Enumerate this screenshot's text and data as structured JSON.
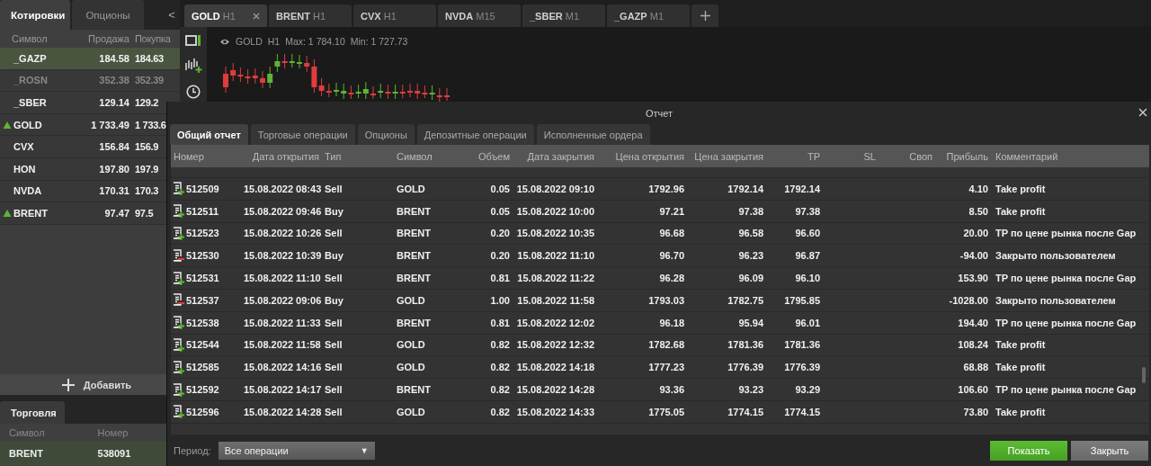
{
  "quotes_panel": {
    "tabs": [
      {
        "label": "Котировки",
        "selected": true
      },
      {
        "label": "Опционы",
        "selected": false
      }
    ],
    "collapse": "<",
    "columns": [
      "Символ",
      "Продажа",
      "Покупка"
    ],
    "rows": [
      {
        "symbol": "_GAZP",
        "sell": "184.58",
        "buy": "184.63",
        "selected": true,
        "disabled": false,
        "up": false
      },
      {
        "symbol": "_ROSN",
        "sell": "352.38",
        "buy": "352.39",
        "selected": false,
        "disabled": true,
        "up": false
      },
      {
        "symbol": "_SBER",
        "sell": "129.14",
        "buy": "129.2",
        "selected": false,
        "disabled": false,
        "up": false
      },
      {
        "symbol": "GOLD",
        "sell": "1 733.49",
        "buy": "1 733.6",
        "selected": false,
        "disabled": false,
        "up": true
      },
      {
        "symbol": "CVX",
        "sell": "156.84",
        "buy": "156.9",
        "selected": false,
        "disabled": false,
        "up": false
      },
      {
        "symbol": "HON",
        "sell": "197.80",
        "buy": "197.9",
        "selected": false,
        "disabled": false,
        "up": false
      },
      {
        "symbol": "NVDA",
        "sell": "170.31",
        "buy": "170.3",
        "selected": false,
        "disabled": false,
        "up": false
      },
      {
        "symbol": "BRENT",
        "sell": "97.47",
        "buy": "97.5",
        "selected": false,
        "disabled": false,
        "up": true
      }
    ],
    "add_button": "Добавить"
  },
  "trading_panel": {
    "tab": "Торговля",
    "columns": [
      "Символ",
      "Номер"
    ],
    "rows": [
      {
        "symbol": "BRENT",
        "number": "538091",
        "selected": true
      }
    ]
  },
  "chart_tabs": [
    {
      "symbol": "GOLD",
      "timeframe": "H1",
      "selected": true
    },
    {
      "symbol": "BRENT",
      "timeframe": "H1",
      "selected": false
    },
    {
      "symbol": "CVX",
      "timeframe": "H1",
      "selected": false
    },
    {
      "symbol": "NVDA",
      "timeframe": "M15",
      "selected": false
    },
    {
      "symbol": "_SBER",
      "timeframe": "M1",
      "selected": false
    },
    {
      "symbol": "_GAZP",
      "timeframe": "M1",
      "selected": false
    }
  ],
  "chart_header": {
    "symbol": "GOLD",
    "timeframe": "H1",
    "max": "Max: 1 784.10",
    "min": "Min: 1 727.73"
  },
  "report": {
    "title": "Отчет",
    "tabs": [
      {
        "label": "Общий отчет",
        "selected": true
      },
      {
        "label": "Торговые операции",
        "selected": false
      },
      {
        "label": "Опционы",
        "selected": false
      },
      {
        "label": "Депозитные операции",
        "selected": false
      },
      {
        "label": "Исполненные ордера",
        "selected": false
      }
    ],
    "columns": [
      "Номер",
      "Дата открытия",
      "Тип",
      "Символ",
      "Объем",
      "Дата закрытия",
      "Цена открытия",
      "Цена закрытия",
      "TP",
      "SL",
      "Своп",
      "Прибыль",
      "Комментарий"
    ],
    "rows": [
      {
        "kind": "plus",
        "cells": [
          "512509",
          "15.08.2022 08:43",
          "Sell",
          "GOLD",
          "0.05",
          "15.08.2022 09:10",
          "1792.96",
          "1792.14",
          "1792.14",
          "",
          "",
          "4.10",
          "Take profit"
        ]
      },
      {
        "kind": "plus",
        "cells": [
          "512511",
          "15.08.2022 09:46",
          "Buy",
          "BRENT",
          "0.05",
          "15.08.2022 10:00",
          "97.21",
          "97.38",
          "97.38",
          "",
          "",
          "8.50",
          "Take profit"
        ]
      },
      {
        "kind": "plus",
        "cells": [
          "512523",
          "15.08.2022 10:26",
          "Sell",
          "BRENT",
          "0.20",
          "15.08.2022 10:35",
          "96.68",
          "96.58",
          "96.60",
          "",
          "",
          "20.00",
          "TP по цене рынка после Gap"
        ]
      },
      {
        "kind": "minus",
        "cells": [
          "512530",
          "15.08.2022 10:39",
          "Buy",
          "BRENT",
          "0.20",
          "15.08.2022 11:10",
          "96.70",
          "96.23",
          "96.87",
          "",
          "",
          "-94.00",
          "Закрыто пользователем"
        ]
      },
      {
        "kind": "plus",
        "cells": [
          "512531",
          "15.08.2022 11:10",
          "Sell",
          "BRENT",
          "0.81",
          "15.08.2022 11:22",
          "96.28",
          "96.09",
          "96.10",
          "",
          "",
          "153.90",
          "TP по цене рынка после Gap"
        ]
      },
      {
        "kind": "minus",
        "cells": [
          "512537",
          "15.08.2022 09:06",
          "Buy",
          "GOLD",
          "1.00",
          "15.08.2022 11:58",
          "1793.03",
          "1782.75",
          "1795.85",
          "",
          "",
          "-1028.00",
          "Закрыто пользователем"
        ]
      },
      {
        "kind": "plus",
        "cells": [
          "512538",
          "15.08.2022 11:33",
          "Sell",
          "BRENT",
          "0.81",
          "15.08.2022 12:02",
          "96.18",
          "95.94",
          "96.01",
          "",
          "",
          "194.40",
          "TP по цене рынка после Gap"
        ]
      },
      {
        "kind": "plus",
        "cells": [
          "512544",
          "15.08.2022 11:58",
          "Sell",
          "GOLD",
          "0.82",
          "15.08.2022 12:32",
          "1782.68",
          "1781.36",
          "1781.36",
          "",
          "",
          "108.24",
          "Take profit"
        ]
      },
      {
        "kind": "plus",
        "cells": [
          "512585",
          "15.08.2022 14:16",
          "Sell",
          "GOLD",
          "0.82",
          "15.08.2022 14:18",
          "1777.23",
          "1776.39",
          "1776.39",
          "",
          "",
          "68.88",
          "Take profit"
        ]
      },
      {
        "kind": "plus",
        "cells": [
          "512592",
          "15.08.2022 14:17",
          "Sell",
          "BRENT",
          "0.82",
          "15.08.2022 14:28",
          "93.36",
          "93.23",
          "93.29",
          "",
          "",
          "106.60",
          "TP по цене рынка после Gap"
        ]
      },
      {
        "kind": "plus",
        "cells": [
          "512596",
          "15.08.2022 14:28",
          "Sell",
          "GOLD",
          "0.82",
          "15.08.2022 14:33",
          "1775.05",
          "1774.15",
          "1774.15",
          "",
          "",
          "73.80",
          "Take profit"
        ]
      }
    ],
    "period_label": "Период:",
    "period_value": "Все операции",
    "dropdown_arrow": "▼",
    "show_button": "Показать",
    "close_button": "Закрыть"
  }
}
